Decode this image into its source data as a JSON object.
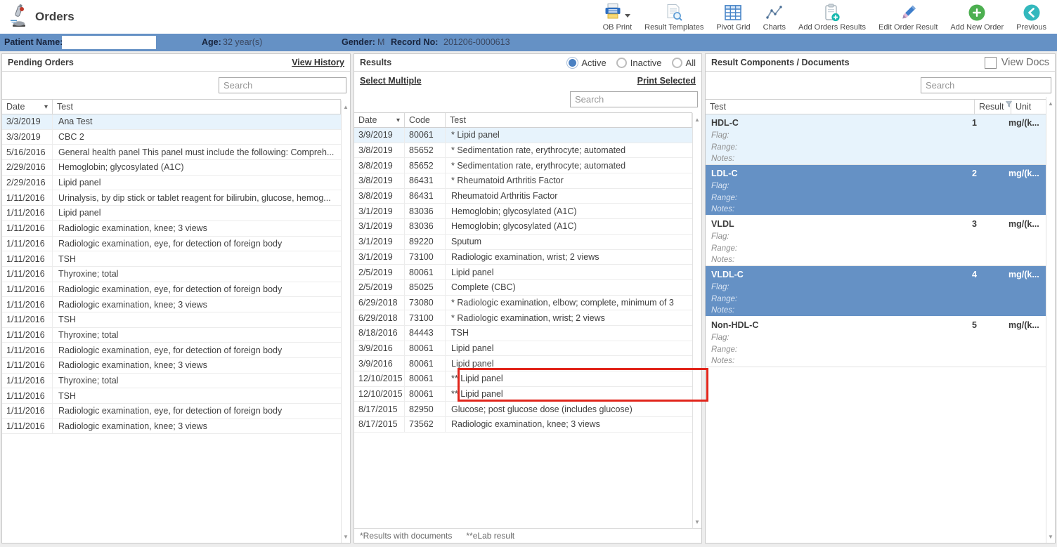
{
  "app": {
    "title": "Orders"
  },
  "toolbar": {
    "items": [
      {
        "label": "OB Print"
      },
      {
        "label": "Result Templates"
      },
      {
        "label": "Pivot Grid"
      },
      {
        "label": "Charts"
      },
      {
        "label": "Add Orders Results"
      },
      {
        "label": "Edit Order Result"
      },
      {
        "label": "Add New Order"
      },
      {
        "label": "Previous"
      }
    ]
  },
  "patient": {
    "name_label": "Patient Name:",
    "name_value": "",
    "age_label": "Age:",
    "age_value": "32 year(s)",
    "gender_label": "Gender:",
    "gender_value": "M",
    "record_label": "Record No:",
    "record_value": "201206-0000613"
  },
  "pending": {
    "title": "Pending Orders",
    "view_history_label": "View History",
    "search_placeholder": "Search",
    "columns": {
      "date": "Date",
      "test": "Test"
    },
    "rows": [
      {
        "date": "3/3/2019",
        "test": "Ana Test",
        "state": "hl"
      },
      {
        "date": "3/3/2019",
        "test": "CBC 2"
      },
      {
        "date": "5/16/2016",
        "test": "General health panel This panel must include the following: Compreh..."
      },
      {
        "date": "2/29/2016",
        "test": "Hemoglobin; glycosylated (A1C)"
      },
      {
        "date": "2/29/2016",
        "test": "Lipid panel"
      },
      {
        "date": "1/11/2016",
        "test": "Urinalysis, by dip stick or tablet reagent for bilirubin, glucose, hemog..."
      },
      {
        "date": "1/11/2016",
        "test": "Lipid panel"
      },
      {
        "date": "1/11/2016",
        "test": "Radiologic examination, knee; 3 views"
      },
      {
        "date": "1/11/2016",
        "test": "Radiologic examination, eye, for detection of foreign body"
      },
      {
        "date": "1/11/2016",
        "test": "TSH"
      },
      {
        "date": "1/11/2016",
        "test": "Thyroxine; total"
      },
      {
        "date": "1/11/2016",
        "test": "Radiologic examination, eye, for detection of foreign body"
      },
      {
        "date": "1/11/2016",
        "test": "Radiologic examination, knee; 3 views"
      },
      {
        "date": "1/11/2016",
        "test": "TSH"
      },
      {
        "date": "1/11/2016",
        "test": "Thyroxine; total"
      },
      {
        "date": "1/11/2016",
        "test": "Radiologic examination, eye, for detection of foreign body"
      },
      {
        "date": "1/11/2016",
        "test": "Radiologic examination, knee; 3 views"
      },
      {
        "date": "1/11/2016",
        "test": "Thyroxine; total"
      },
      {
        "date": "1/11/2016",
        "test": "TSH"
      },
      {
        "date": "1/11/2016",
        "test": "Radiologic examination, eye, for detection of foreign body"
      },
      {
        "date": "1/11/2016",
        "test": "Radiologic examination, knee; 3 views"
      }
    ]
  },
  "results": {
    "title": "Results",
    "filters": [
      {
        "label": "Active",
        "sel": "on"
      },
      {
        "label": "Inactive"
      },
      {
        "label": "All"
      }
    ],
    "select_multiple_label": "Select Multiple",
    "print_selected_label": "Print Selected",
    "search_placeholder": "Search",
    "columns": {
      "date": "Date",
      "code": "Code",
      "test": "Test"
    },
    "rows": [
      {
        "date": "3/9/2019",
        "code": "80061",
        "test": "* Lipid panel",
        "state": "hl"
      },
      {
        "date": "3/8/2019",
        "code": "85652",
        "test": "* Sedimentation rate, erythrocyte; automated"
      },
      {
        "date": "3/8/2019",
        "code": "85652",
        "test": "* Sedimentation rate, erythrocyte; automated"
      },
      {
        "date": "3/8/2019",
        "code": "86431",
        "test": "* Rheumatoid Arthritis Factor"
      },
      {
        "date": "3/8/2019",
        "code": "86431",
        "test": "Rheumatoid Arthritis Factor"
      },
      {
        "date": "3/1/2019",
        "code": "83036",
        "test": "Hemoglobin; glycosylated (A1C)"
      },
      {
        "date": "3/1/2019",
        "code": "83036",
        "test": "Hemoglobin; glycosylated (A1C)"
      },
      {
        "date": "3/1/2019",
        "code": "89220",
        "test": "Sputum"
      },
      {
        "date": "3/1/2019",
        "code": "73100",
        "test": "Radiologic examination, wrist; 2 views"
      },
      {
        "date": "2/5/2019",
        "code": "80061",
        "test": "Lipid panel"
      },
      {
        "date": "2/5/2019",
        "code": "85025",
        "test": "Complete (CBC)"
      },
      {
        "date": "6/29/2018",
        "code": "73080",
        "test": "* Radiologic examination, elbow; complete, minimum of 3"
      },
      {
        "date": "6/29/2018",
        "code": "73100",
        "test": "* Radiologic examination, wrist; 2 views"
      },
      {
        "date": "8/18/2016",
        "code": "84443",
        "test": "TSH"
      },
      {
        "date": "3/9/2016",
        "code": "80061",
        "test": "Lipid panel"
      },
      {
        "date": "3/9/2016",
        "code": "80061",
        "test": "Lipid panel"
      },
      {
        "date": "12/10/2015",
        "code": "80061",
        "test": "** Lipid panel"
      },
      {
        "date": "12/10/2015",
        "code": "80061",
        "test": "** Lipid panel"
      },
      {
        "date": "8/17/2015",
        "code": "82950",
        "test": "Glucose; post glucose dose (includes glucose)"
      },
      {
        "date": "8/17/2015",
        "code": "73562",
        "test": "Radiologic examination, knee; 3 views"
      }
    ],
    "footnote_documents": "*Results with documents",
    "footnote_elab": "**eLab result"
  },
  "components": {
    "title": "Result Components / Documents",
    "view_docs_label": "View Docs",
    "search_placeholder": "Search",
    "columns": {
      "test": "Test",
      "result": "Result",
      "unit": "Unit"
    },
    "rows": [
      {
        "test": "HDL-C",
        "result": "1",
        "unit": "mg/(k...",
        "flag_label": "Flag:",
        "range_label": "Range:",
        "notes_label": "Notes:",
        "state": "hl"
      },
      {
        "test": "LDL-C",
        "result": "2",
        "unit": "mg/(k...",
        "flag_label": "Flag:",
        "range_label": "Range:",
        "notes_label": "Notes:",
        "state": "sel"
      },
      {
        "test": "VLDL",
        "result": "3",
        "unit": "mg/(k...",
        "flag_label": "Flag:",
        "range_label": "Range:",
        "notes_label": "Notes:"
      },
      {
        "test": "VLDL-C",
        "result": "4",
        "unit": "mg/(k...",
        "flag_label": "Flag:",
        "range_label": "Range:",
        "notes_label": "Notes:",
        "state": "sel"
      },
      {
        "test": "Non-HDL-C",
        "result": "5",
        "unit": "mg/(k...",
        "flag_label": "Flag:",
        "range_label": "Range:",
        "notes_label": "Notes:"
      }
    ]
  },
  "colors": {
    "accent_blue": "#6591c5",
    "row_highlight": "#e7f3fc",
    "annotation_red": "#e1251b",
    "add_green": "#4caf50",
    "previous_teal": "#33b8bd"
  }
}
